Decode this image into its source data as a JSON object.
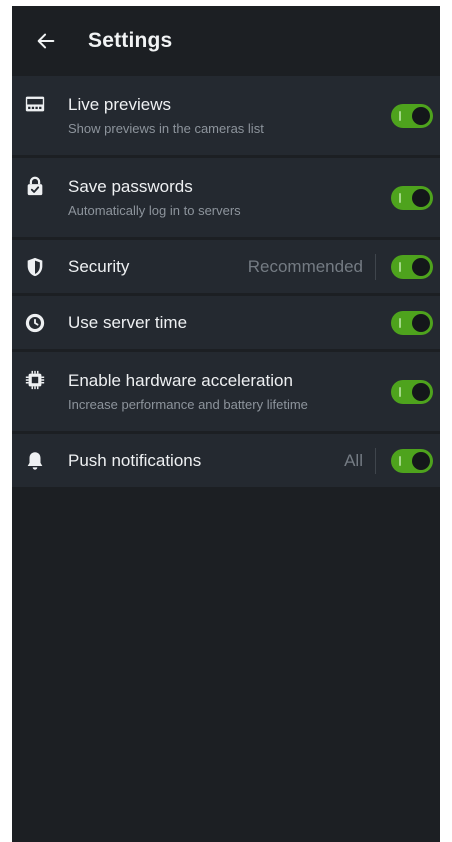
{
  "header": {
    "title": "Settings",
    "back_icon": "arrow-left-icon"
  },
  "settings": [
    {
      "key": "live_previews",
      "icon": "film-strip-icon",
      "title": "Live previews",
      "subtitle": "Show previews in the cameras list",
      "enabled": true
    },
    {
      "key": "save_passwords",
      "icon": "lock-check-icon",
      "title": "Save passwords",
      "subtitle": "Automatically log in to servers",
      "enabled": true
    },
    {
      "key": "security",
      "icon": "shield-icon",
      "title": "Security",
      "value": "Recommended",
      "enabled": true
    },
    {
      "key": "use_server_time",
      "icon": "clock-icon",
      "title": "Use server time",
      "enabled": true
    },
    {
      "key": "hardware_acceleration",
      "icon": "chip-icon",
      "title": "Enable hardware acceleration",
      "subtitle": "Increase performance and battery lifetime",
      "enabled": true
    },
    {
      "key": "push_notifications",
      "icon": "bell-icon",
      "title": "Push notifications",
      "value": "All",
      "enabled": true
    }
  ],
  "colors": {
    "background": "#1c1f23",
    "row_background": "#242930",
    "toggle_on": "#4ea31d",
    "text_primary": "#eef0f2",
    "text_secondary": "#8d949c"
  }
}
